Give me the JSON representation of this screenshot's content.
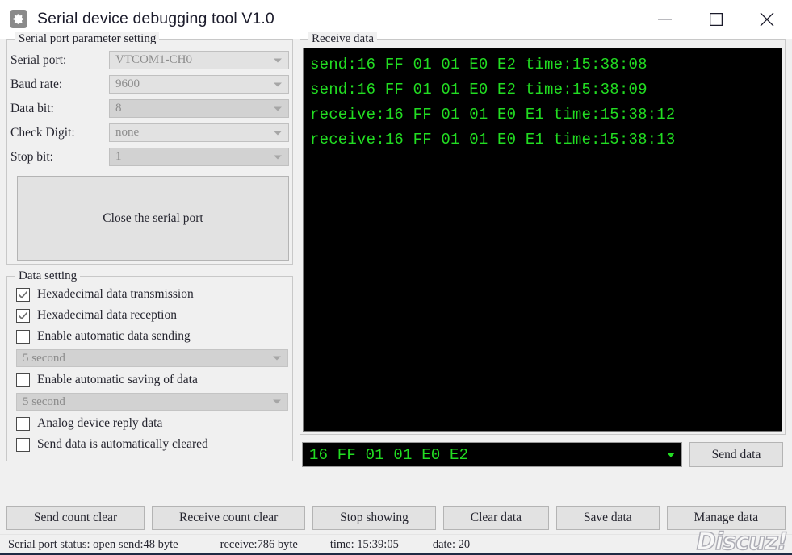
{
  "window": {
    "title": "Serial device debugging tool V1.0",
    "icon": "gear-icon",
    "minimize": "—",
    "maximize": "□",
    "close": "✕"
  },
  "serial_params": {
    "group_title": "Serial port parameter setting",
    "rows": [
      {
        "label": "Serial port:",
        "value": "VTCOM1-CH0",
        "disabled": true
      },
      {
        "label": "Baud rate:",
        "value": "9600",
        "disabled": true
      },
      {
        "label": "Data bit:",
        "value": "8",
        "disabled": true
      },
      {
        "label": "Check Digit:",
        "value": "none",
        "disabled": true
      },
      {
        "label": "Stop bit:",
        "value": "1",
        "disabled": true
      }
    ],
    "port_button": "Close the serial port"
  },
  "data_setting": {
    "group_title": "Data setting",
    "checkboxes": [
      {
        "label": "Hexadecimal data transmission",
        "checked": true
      },
      {
        "label": "Hexadecimal data reception",
        "checked": true
      },
      {
        "label": "Enable automatic data sending",
        "checked": false
      },
      {
        "label": "Enable automatic saving of data",
        "checked": false
      },
      {
        "label": "Analog device reply data",
        "checked": false
      },
      {
        "label": "Send data is automatically cleared",
        "checked": false
      }
    ],
    "auto_send_interval": "5 second",
    "auto_save_interval": "5 second"
  },
  "receive": {
    "group_title": "Receive data",
    "lines": [
      "send:16 FF 01 01 E0 E2 time:15:38:08",
      "send:16 FF 01 01 E0 E2 time:15:38:09",
      "receive:16 FF 01 01 E0 E1 time:15:38:12",
      "receive:16 FF 01 01 E0 E1 time:15:38:13"
    ],
    "text_color": "#22dd22",
    "background_color": "#000000"
  },
  "send": {
    "input_value": "16 FF 01 01 E0 E2",
    "button_label": "Send data"
  },
  "buttons": [
    "Send count clear",
    "Receive count clear",
    "Stop showing",
    "Clear data",
    "Save data",
    "Manage data"
  ],
  "status": {
    "port_status": "Serial port status: open send:48 byte",
    "receive_count": "receive:786 byte",
    "time": "time: 15:39:05",
    "date": "date: 20"
  },
  "watermark": "Discuz!"
}
